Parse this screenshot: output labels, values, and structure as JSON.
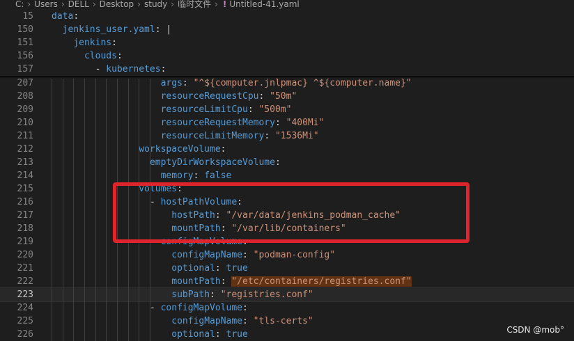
{
  "breadcrumb": {
    "items": [
      "C:",
      "Users",
      "DELL",
      "Desktop",
      "study",
      "临时文件"
    ],
    "file_icon": "!",
    "file": "Untitled-41.yaml"
  },
  "lines": [
    {
      "n": "15",
      "indent": 0,
      "key": "data",
      "sep": ":",
      "val": ""
    },
    {
      "n": "150",
      "indent": 1,
      "key": "jenkins_user.yaml",
      "sep": ": ",
      "val": "|"
    },
    {
      "n": "151",
      "indent": 2,
      "key": "jenkins",
      "sep": ":",
      "val": ""
    },
    {
      "n": "156",
      "indent": 3,
      "key": "clouds",
      "sep": ":",
      "val": ""
    },
    {
      "n": "157",
      "indent": 4,
      "dash": "- ",
      "key": "kubernetes",
      "sep": ":",
      "val": ""
    },
    {
      "n": "207",
      "indent": 10,
      "key": "args",
      "sep": ": ",
      "val": "\"^${computer.jnlpmac} ^${computer.name}\""
    },
    {
      "n": "208",
      "indent": 10,
      "key": "resourceRequestCpu",
      "sep": ": ",
      "val": "\"50m\""
    },
    {
      "n": "209",
      "indent": 10,
      "key": "resourceLimitCpu",
      "sep": ": ",
      "val": "\"500m\""
    },
    {
      "n": "210",
      "indent": 10,
      "key": "resourceRequestMemory",
      "sep": ": ",
      "val": "\"400Mi\""
    },
    {
      "n": "211",
      "indent": 10,
      "key": "resourceLimitMemory",
      "sep": ": ",
      "val": "\"1536Mi\""
    },
    {
      "n": "212",
      "indent": 8,
      "key": "workspaceVolume",
      "sep": ":",
      "val": ""
    },
    {
      "n": "213",
      "indent": 9,
      "key": "emptyDirWorkspaceVolume",
      "sep": ":",
      "val": ""
    },
    {
      "n": "214",
      "indent": 10,
      "key": "memory",
      "sep": ": ",
      "val": "false",
      "valtype": "k"
    },
    {
      "n": "215",
      "indent": 8,
      "key": "volumes",
      "sep": ":",
      "val": ""
    },
    {
      "n": "216",
      "indent": 9,
      "dash": "- ",
      "key": "hostPathVolume",
      "sep": ":",
      "val": ""
    },
    {
      "n": "217",
      "indent": 11,
      "key": "hostPath",
      "sep": ": ",
      "val": "\"/var/data/jenkins_podman_cache\""
    },
    {
      "n": "218",
      "indent": 11,
      "key": "mountPath",
      "sep": ": ",
      "val": "\"/var/lib/containers\""
    },
    {
      "n": "219",
      "indent": 9,
      "dash": "- ",
      "key": "configMapVolume",
      "sep": ":",
      "val": ""
    },
    {
      "n": "220",
      "indent": 11,
      "key": "configMapName",
      "sep": ": ",
      "val": "\"podman-config\""
    },
    {
      "n": "221",
      "indent": 11,
      "key": "optional",
      "sep": ": ",
      "val": "true",
      "valtype": "k"
    },
    {
      "n": "222",
      "indent": 11,
      "key": "mountPath",
      "sep": ": ",
      "val": "\"/etc/containers/registries.conf\"",
      "selected": true
    },
    {
      "n": "223",
      "indent": 11,
      "key": "subPath",
      "sep": ": ",
      "val": "\"registries.conf\"",
      "active": true
    },
    {
      "n": "224",
      "indent": 9,
      "dash": "- ",
      "key": "configMapVolume",
      "sep": ":",
      "val": ""
    },
    {
      "n": "225",
      "indent": 11,
      "key": "configMapName",
      "sep": ": ",
      "val": "\"tls-certs\""
    },
    {
      "n": "226",
      "indent": 11,
      "key": "optional",
      "sep": ": ",
      "val": "true",
      "valtype": "k"
    }
  ],
  "watermark": "CSDN @mob°"
}
